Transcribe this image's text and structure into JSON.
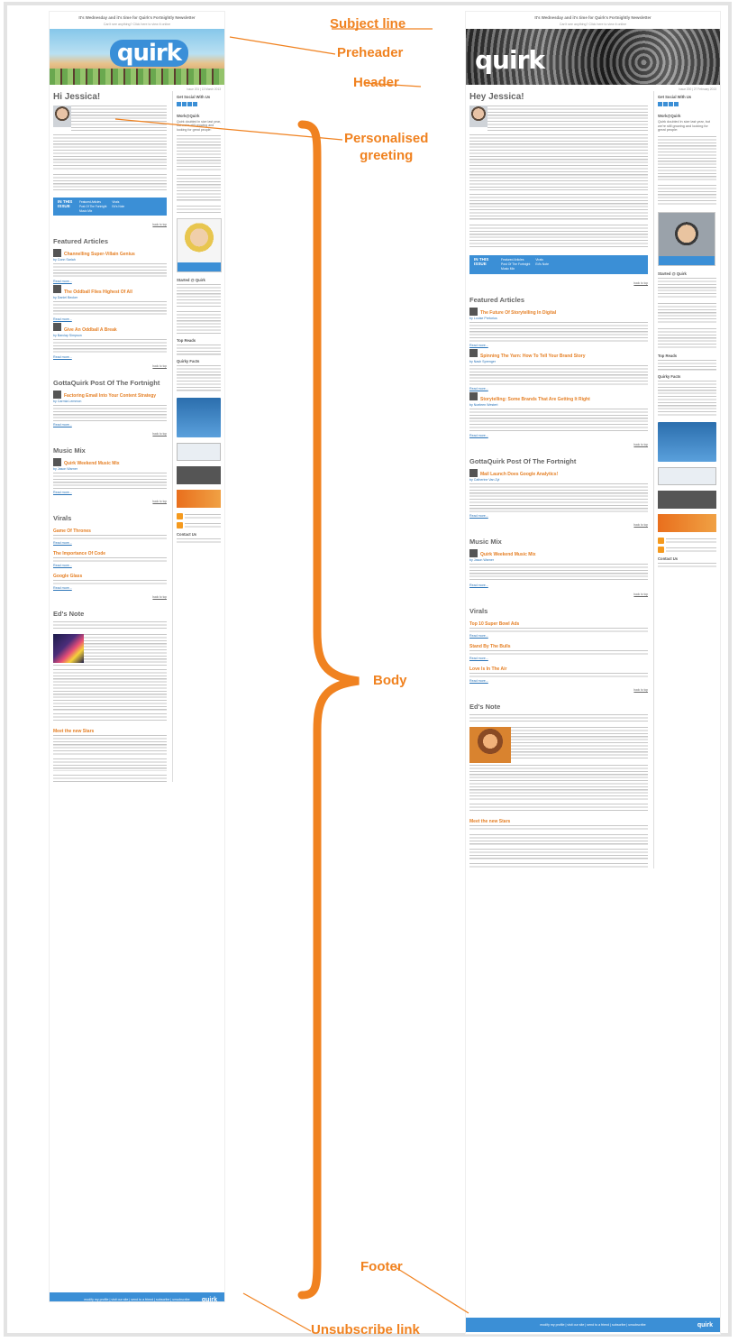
{
  "labels": {
    "subject_line": "Subject line",
    "preheader": "Preheader",
    "header": "Header",
    "greeting_line1": "Personalised",
    "greeting_line2": "greeting",
    "body": "Body",
    "footer": "Footer",
    "unsubscribe": "Unsubscribe link"
  },
  "accent_color": "#f08220",
  "newsletter_left": {
    "subject": "It's Wednesday and it's time for Quirk's Fortnightly Newsletter",
    "preheader": "Can't see anything? Click here to view it online",
    "logo": "quirk",
    "issue": "Issue 201 | 13 March 2013",
    "greeting": "Hi Jessica!",
    "box_label": "IN THIS ISSUE",
    "box_links": [
      "Featured Articles",
      "Post Of The Fortnight",
      "Music Mix",
      "Virals",
      "Ed's Note"
    ],
    "sections": [
      {
        "title": "Featured Articles",
        "articles": [
          {
            "title": "Channelling Super-Villain Genius",
            "by": "by Conn Sarlah"
          },
          {
            "title": "The Oddball Flies Highest Of All",
            "by": "by Daniel Becker"
          },
          {
            "title": "Give An Oddball A Break",
            "by": "by Barclay Simpson"
          }
        ]
      },
      {
        "title": "GottaQuirk Post Of The Fortnight",
        "articles": [
          {
            "title": "Factoring Email Into Your Content Strategy",
            "by": "by Carmia Lemmon"
          }
        ]
      },
      {
        "title": "Music Mix",
        "articles": [
          {
            "title": "Quirk Weekend Music Mix",
            "by": "by Jason Warner"
          }
        ]
      },
      {
        "title": "Virals",
        "articles": [
          {
            "title": "Game Of Thrones",
            "by": ""
          },
          {
            "title": "The Importance Of Code",
            "by": ""
          },
          {
            "title": "Google Glass",
            "by": ""
          }
        ]
      }
    ],
    "eds_note": "Ed's Note",
    "new_stars": "Meet the new Stars",
    "read_more": "Read more...",
    "back_to_top": "back to top",
    "side": {
      "social": "Get Social With Us",
      "work": "Work@Quirk",
      "work_text": "Quirk doubled in size last year, but we're still growing and looking for great people:",
      "started": "Started @ Quirk",
      "top_reads": "Top Reads",
      "quirky_facts": "Quirky Facts",
      "contact": "Contact Us",
      "portrait_name": "Abby Mills"
    },
    "footer": "modify my profile | visit our site | send to a friend | subscribe | unsubscribe",
    "footer_logo": "quirk"
  },
  "newsletter_right": {
    "subject": "It's Wednesday and it's time for Quirk's Fortnightly Newsletter",
    "preheader": "Can't see anything? Click here to view it online",
    "logo": "quirk",
    "issue": "Issue 200 | 27 February 2013",
    "greeting": "Hey Jessica!",
    "box_label": "IN THIS ISSUE",
    "box_links": [
      "Featured Articles",
      "Post Of The Fortnight",
      "Music Mix",
      "Virals",
      "Ed's Note"
    ],
    "sections": [
      {
        "title": "Featured Articles",
        "articles": [
          {
            "title": "The Future Of Storytelling In Digital",
            "by": "by Louise Pretorius"
          },
          {
            "title": "Spinning The Yarn: How To Tell Your Brand Story",
            "by": "by Nash Sprenger"
          },
          {
            "title": "Storytelling: Some Brands That Are Getting It Right",
            "by": "by Noeleen Westert"
          }
        ]
      },
      {
        "title": "GottaQuirk Post Of The Fortnight",
        "articles": [
          {
            "title": "Mail Launch Does Google Analytics!",
            "by": "by Catherine Van Zyl"
          }
        ]
      },
      {
        "title": "Music Mix",
        "articles": [
          {
            "title": "Quirk Weekend Music Mix",
            "by": "by Jason Warner"
          }
        ]
      },
      {
        "title": "Virals",
        "articles": [
          {
            "title": "Top 10 Super Bowl Ads",
            "by": ""
          },
          {
            "title": "Stand By The Bulls",
            "by": ""
          },
          {
            "title": "Love Is In The Air",
            "by": ""
          }
        ]
      }
    ],
    "eds_note": "Ed's Note",
    "new_stars": "Meet the new Stars",
    "read_more": "Read more...",
    "back_to_top": "back to top",
    "side": {
      "social": "Get Social With Us",
      "work": "Work@Quirk",
      "work_text": "Quirk doubled in size last year, but we're still growing and looking for great people:",
      "started": "Started @ Quirk",
      "top_reads": "Top Reads",
      "quirky_facts": "Quirky Facts",
      "contact": "Contact Us",
      "portrait_name": "Ben Brookbank"
    },
    "footer": "modify my profile | visit our site | send to a friend | subscribe | unsubscribe",
    "footer_logo": "quirk"
  }
}
